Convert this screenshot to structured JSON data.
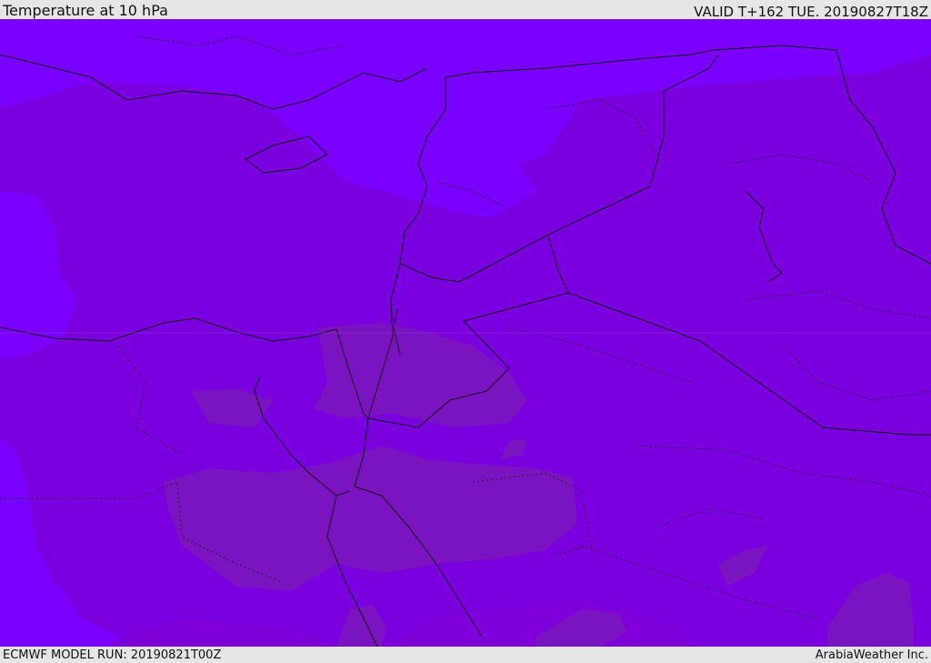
{
  "header": {
    "title": "Temperature at 10 hPa",
    "valid": "VALID T+162 TUE. 20190827T18Z"
  },
  "footer": {
    "model_run": "ECMWF MODEL RUN: 20190821T00Z",
    "brand": "ArabiaWeather Inc."
  },
  "map": {
    "region": "Eastern Mediterranean and Middle East",
    "field": "temperature",
    "colors": {
      "coldest": "#7a00ff",
      "cold": "#7d00e6",
      "cool": "#8000d8",
      "warm": "#7b14bf",
      "warmest": "#8a19b0",
      "borders": "#111111"
    }
  }
}
